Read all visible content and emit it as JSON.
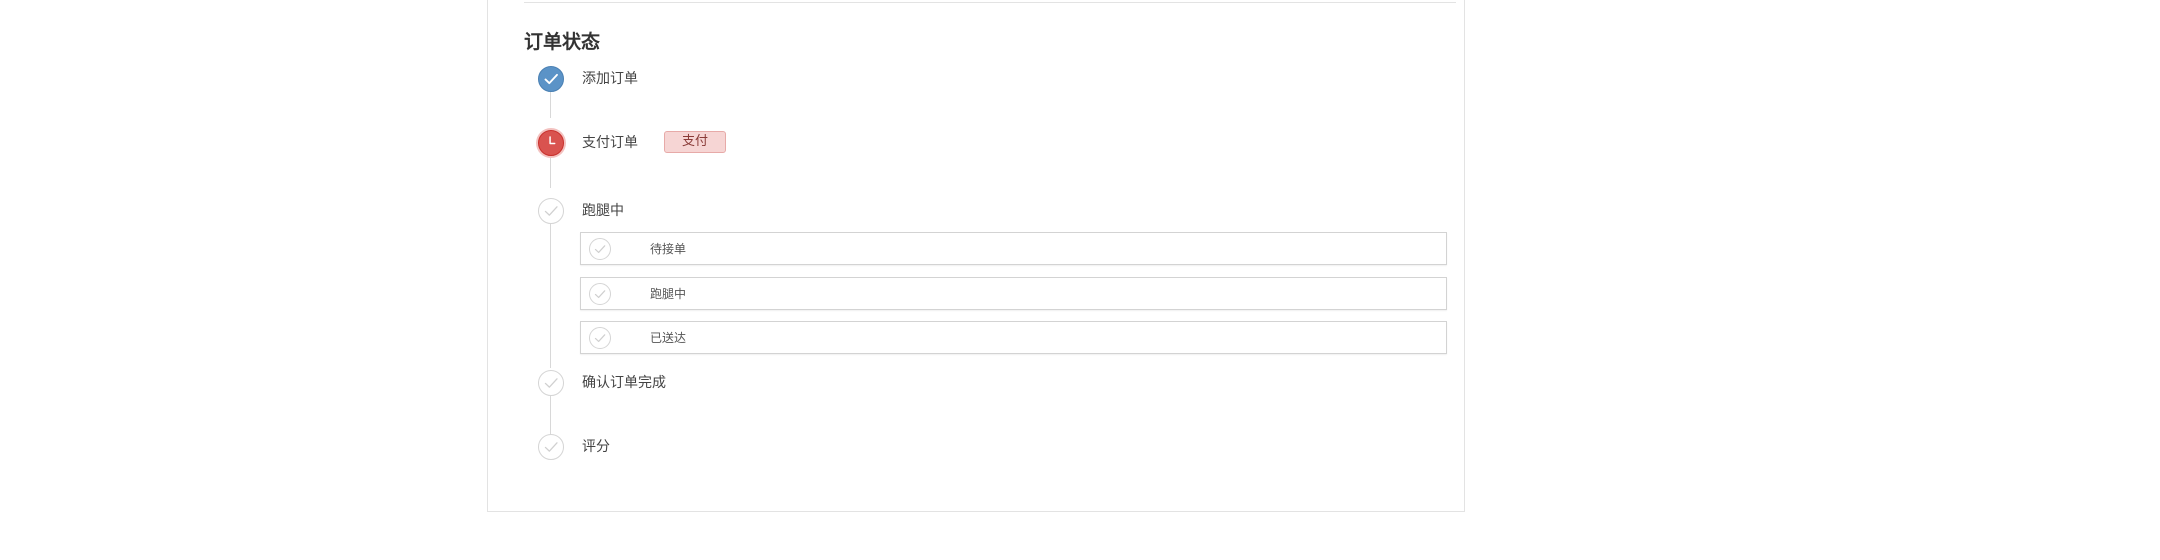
{
  "order_status": {
    "title": "订单状态",
    "steps": [
      {
        "label": "添加订单",
        "state": "done",
        "icon": "check-icon"
      },
      {
        "label": "支付订单",
        "state": "current",
        "icon": "clock-icon",
        "action_label": "支付"
      },
      {
        "label": "跑腿中",
        "state": "pending",
        "icon": "check-icon",
        "substeps": [
          {
            "label": "待接单",
            "state": "pending",
            "icon": "check-icon"
          },
          {
            "label": "跑腿中",
            "state": "pending",
            "icon": "check-icon"
          },
          {
            "label": "已送达",
            "state": "pending",
            "icon": "check-icon"
          }
        ]
      },
      {
        "label": "确认订单完成",
        "state": "pending",
        "icon": "check-icon"
      },
      {
        "label": "评分",
        "state": "pending",
        "icon": "check-icon"
      }
    ]
  },
  "colors": {
    "done": "#5b93c7",
    "current": "#d9534f",
    "pending_border": "#d5d5d5",
    "pay_button_bg": "#f6d5d4"
  }
}
